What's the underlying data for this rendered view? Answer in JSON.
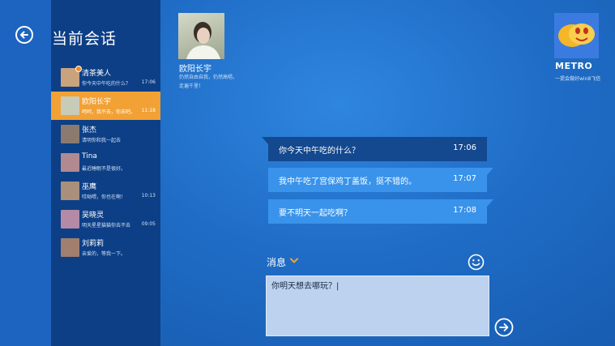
{
  "header": {
    "title": "当前会话"
  },
  "contacts": [
    {
      "name": "清茶美人",
      "message": "你今天中午吃的什么？",
      "time": "17:06",
      "badge": true,
      "avatar_color": "#c9a27e"
    },
    {
      "name": "欧阳长宇",
      "message": "呵呵，我不去，你去吧。",
      "time": "11:18",
      "active": true,
      "avatar_color": "#c8cbb8"
    },
    {
      "name": "张杰",
      "message": "清明你和我一起去",
      "time": "",
      "avatar_color": "#8b7a70"
    },
    {
      "name": "Tina",
      "message": "最近睡眠不是很好。",
      "time": "",
      "avatar_color": "#b08a90"
    },
    {
      "name": "巫鹰",
      "message": "哎呦喂，你也在啊！",
      "time": "10:13",
      "avatar_color": "#a98f7c"
    },
    {
      "name": "吴晓灵",
      "message": "明天星星猫猫你去不去",
      "time": "09:05",
      "avatar_color": "#b48aa6"
    },
    {
      "name": "刘莉莉",
      "message": "亲爱的，等我一下。",
      "time": "",
      "avatar_color": "#a07f6e"
    }
  ],
  "profile": {
    "name": "欧阳长宇",
    "status_line1": "仍然自由自我，仍然高唱，",
    "status_line2": "走遍千里！"
  },
  "app": {
    "name": "METRO",
    "tagline": "一提会做好win8飞信"
  },
  "messages": [
    {
      "text": "你今天中午吃的什么？",
      "time": "17:06"
    },
    {
      "text": "我中午吃了宫保鸡丁盖饭，挺不错的。",
      "time": "17:07"
    },
    {
      "text": "要不明天一起吃啊？",
      "time": "17:08"
    }
  ],
  "composer": {
    "label": "消息",
    "value": "你明天想去哪玩？|"
  },
  "colors": {
    "sidebar": "#0d3f86",
    "active": "#f2a134",
    "incoming": "#14488f",
    "outgoing": "#3a93eb"
  },
  "icons": {
    "back": "back-arrow-icon",
    "emoji": "smiley-icon",
    "send": "send-arrow-icon",
    "dropdown": "chevron-down-icon"
  }
}
